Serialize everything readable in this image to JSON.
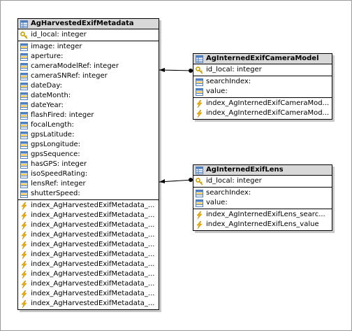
{
  "tables": {
    "harvested": {
      "title": "AgHarvestedExifMetadata",
      "pk": [
        {
          "label": "id_local: integer",
          "icon": "key-icon"
        }
      ],
      "columns": [
        "image: integer",
        "aperture:",
        "cameraModelRef: integer",
        "cameraSNRef: integer",
        "dateDay:",
        "dateMonth:",
        "dateYear:",
        "flashFired: integer",
        "focalLength:",
        "gpsLatitude:",
        "gpsLongitude:",
        "gpsSequence:",
        "hasGPS: integer",
        "isoSpeedRating:",
        "lensRef: integer",
        "shutterSpeed:"
      ],
      "indexes": [
        "index_AgHarvestedExifMetadata_...",
        "index_AgHarvestedExifMetadata_...",
        "index_AgHarvestedExifMetadata_...",
        "index_AgHarvestedExifMetadata_...",
        "index_AgHarvestedExifMetadata_...",
        "index_AgHarvestedExifMetadata_...",
        "index_AgHarvestedExifMetadata_...",
        "index_AgHarvestedExifMetadata_...",
        "index_AgHarvestedExifMetadata_...",
        "index_AgHarvestedExifMetadata_...",
        "index_AgHarvestedExifMetadata_..."
      ]
    },
    "camera": {
      "title": "AgInternedExifCameraModel",
      "pk": [
        {
          "label": "id_local: integer",
          "icon": "key-icon"
        }
      ],
      "columns": [
        "searchIndex:",
        "value:"
      ],
      "indexes": [
        "index_AgInternedExifCameraMod...",
        "index_AgInternedExifCameraMod..."
      ]
    },
    "lens": {
      "title": "AgInternedExifLens",
      "pk": [
        {
          "label": "id_local: integer",
          "icon": "key-icon"
        }
      ],
      "columns": [
        "searchIndex:",
        "value:"
      ],
      "indexes": [
        "index_AgInternedExifLens_searc...",
        "index_AgInternedExifLens_value"
      ]
    }
  },
  "icons": {
    "table": "table-icon",
    "key": "key-icon",
    "column": "column-icon",
    "index": "lightning-index-icon"
  },
  "colors": {
    "header_bg": "#d8d8d8",
    "table_icon_blue": "#4f7fbf",
    "key_gold": "#c9a000",
    "index_orange": "#e8a000"
  }
}
